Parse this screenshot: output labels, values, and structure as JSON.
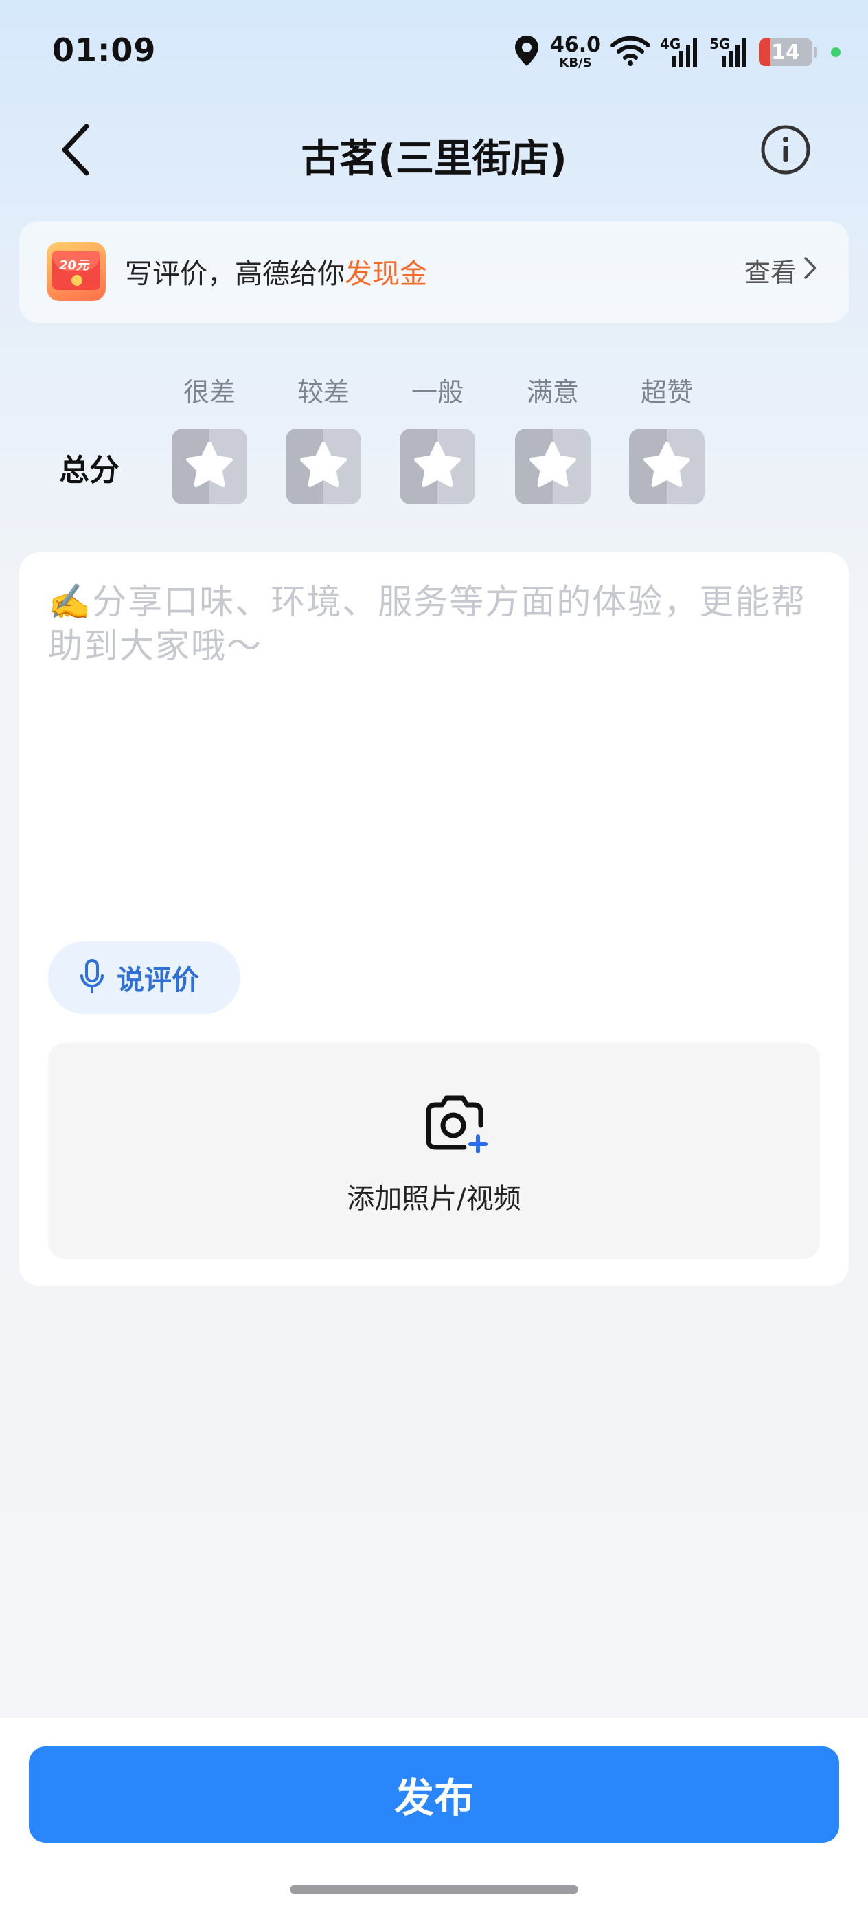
{
  "status_bar": {
    "time": "01:09",
    "net_speed_value": "46.0",
    "net_speed_unit": "KB/S",
    "signal_1": "4G",
    "signal_2": "5G",
    "battery": "14",
    "icons": [
      "location-icon",
      "wifi-icon",
      "signal-4g-icon",
      "signal-5g-icon",
      "battery-icon"
    ]
  },
  "header": {
    "title": "古茗(三里街店)"
  },
  "promo": {
    "icon_text": "20元",
    "text_prefix": "写评价，高德给你",
    "text_highlight": "发现金",
    "link_label": "查看",
    "highlight_color": "#f46a28"
  },
  "rating": {
    "total_label": "总分",
    "levels": [
      "很差",
      "较差",
      "一般",
      "满意",
      "超赞"
    ],
    "selected": 0
  },
  "review": {
    "placeholder": "✍️分享口味、环境、服务等方面的体验，更能帮助到大家哦～",
    "value": "",
    "voice_label": "说评价",
    "upload_label": "添加照片/视频"
  },
  "footer": {
    "publish_label": "发布",
    "accent_color": "#2a86fb"
  }
}
